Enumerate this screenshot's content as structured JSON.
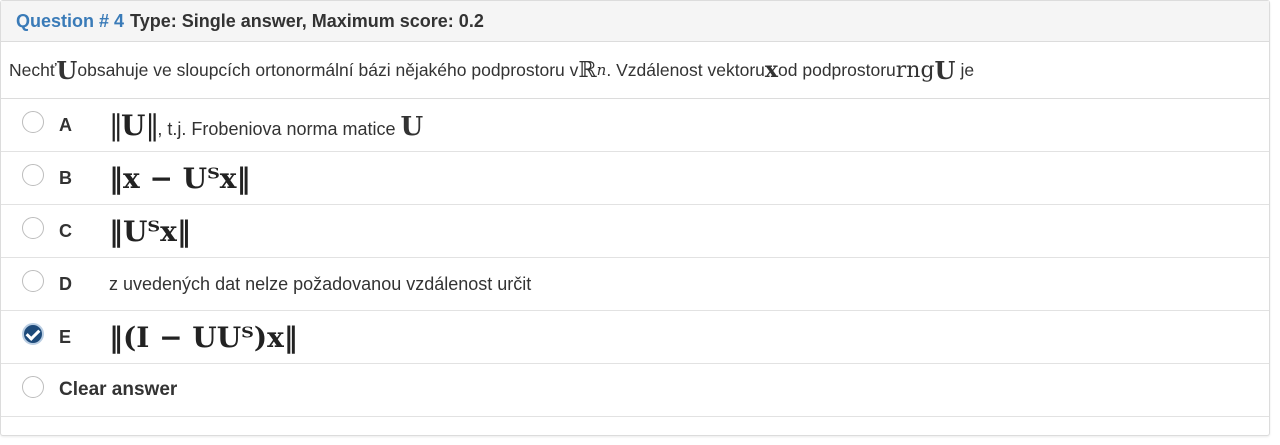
{
  "header": {
    "question_label": "Question # 4",
    "type_text": "Type: Single answer, Maximum score: 0.2"
  },
  "question": {
    "part1": "Nechť ",
    "sym_U": "U",
    "part2": " obsahuje ve sloupcích ortonormální bázi nějakého podprostoru v ",
    "sym_R": "ℝ",
    "sym_n": "n",
    "part3": ". Vzdálenost vektoru ",
    "sym_x": "x",
    "part4": " od podprostoru ",
    "sym_rng": "rng",
    "sym_U2": "U",
    "part5": " je"
  },
  "answers": [
    {
      "letter": "A",
      "formula_pre": "‖",
      "formula_main": "U",
      "formula_post": "‖",
      "suffix_text": ", t.j. Frobeniova norma matice ",
      "suffix_sym": "U",
      "checked": false
    },
    {
      "letter": "B",
      "formula_text": "‖x − Uᵀx‖",
      "checked": false
    },
    {
      "letter": "C",
      "formula_text": "‖Uᵀx‖",
      "checked": false
    },
    {
      "letter": "D",
      "text": "z uvedených dat nelze požadovanou vzdálenost určit",
      "checked": false
    },
    {
      "letter": "E",
      "formula_text": "‖(I − UUᵀ)x‖",
      "checked": true
    }
  ],
  "clear": {
    "label": "Clear answer"
  }
}
